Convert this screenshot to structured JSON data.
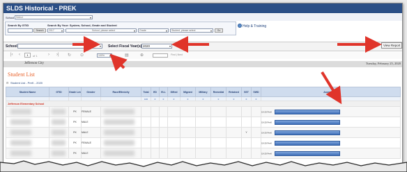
{
  "window": {
    "title": "SLDS Historical - PREK"
  },
  "top_school": {
    "label": "School",
    "value": "Select"
  },
  "search": {
    "by_id_label": "Search By GTID",
    "by_name_label": "Search By Your: System, School, Grade and Student",
    "search_button": "Search",
    "grade_value": "2017",
    "school_placeholder": "School, please select",
    "grade_placeholder": "Grade",
    "student_placeholder": "Student, please select",
    "go_button": "Go",
    "help_link": "Help & Training"
  },
  "params": {
    "school_label": "School",
    "fiscal_year_label": "Select Fiscal Year(s)",
    "fiscal_year_value": "2020",
    "view_report_button": "View Report"
  },
  "toolbar": {
    "first_icon": "first-page-icon",
    "prev_icon": "previous-page-icon",
    "page_value": "1",
    "page_of": "of 1",
    "next_icon": "next-page-icon",
    "last_icon": "last-page-icon",
    "refresh_icon": "refresh-icon",
    "zoom_value": "100%",
    "export_icon": "export-icon",
    "print_icon": "print-icon",
    "find_link": "Find | Next"
  },
  "report": {
    "district": "Jefferson City",
    "date": "Tuesday, February 25, 2020",
    "list_title": "Student List",
    "list_header": "Student List - PreK - 2020",
    "columns": [
      "Student Name",
      "GTID",
      "Grade Level",
      "Gender",
      "Race/Ethnicity",
      "Total",
      "ED",
      "ELL",
      "Gifted",
      "Migrant",
      "Military",
      "Remedial",
      "Retained",
      "SST",
      "SWD",
      "Assessment"
    ],
    "sub_row": [
      "",
      "",
      "",
      "",
      "",
      "100",
      "0",
      "0",
      "0",
      "0",
      "0",
      "0",
      "0",
      "0",
      "0",
      ""
    ],
    "school_name": "Jefferson Elementary School",
    "rows": [
      {
        "grade": "PK",
        "gender": "FEMALE",
        "sst": "",
        "assessment_label": "19-20 PreK",
        "bar_label": "Test"
      },
      {
        "grade": "PK",
        "gender": "MALE",
        "sst": "",
        "assessment_label": "19-20 PreK",
        "bar_label": "Test"
      },
      {
        "grade": "PK",
        "gender": "MALE",
        "sst": "Y",
        "assessment_label": "19-20 PreK",
        "bar_label": "Test"
      },
      {
        "grade": "PK",
        "gender": "FEMALE",
        "sst": "",
        "assessment_label": "19-20 PreK",
        "bar_label": "Test"
      },
      {
        "grade": "PK",
        "gender": "MALE",
        "sst": "",
        "assessment_label": "19-20 PreK",
        "bar_label": "Test"
      }
    ]
  },
  "colors": {
    "title_bar": "#2b4f86",
    "accent_orange": "#e8632c",
    "school_red": "#d02c1c",
    "arrow_red": "#e0342a",
    "bar_blue": "#3f6fb8"
  }
}
